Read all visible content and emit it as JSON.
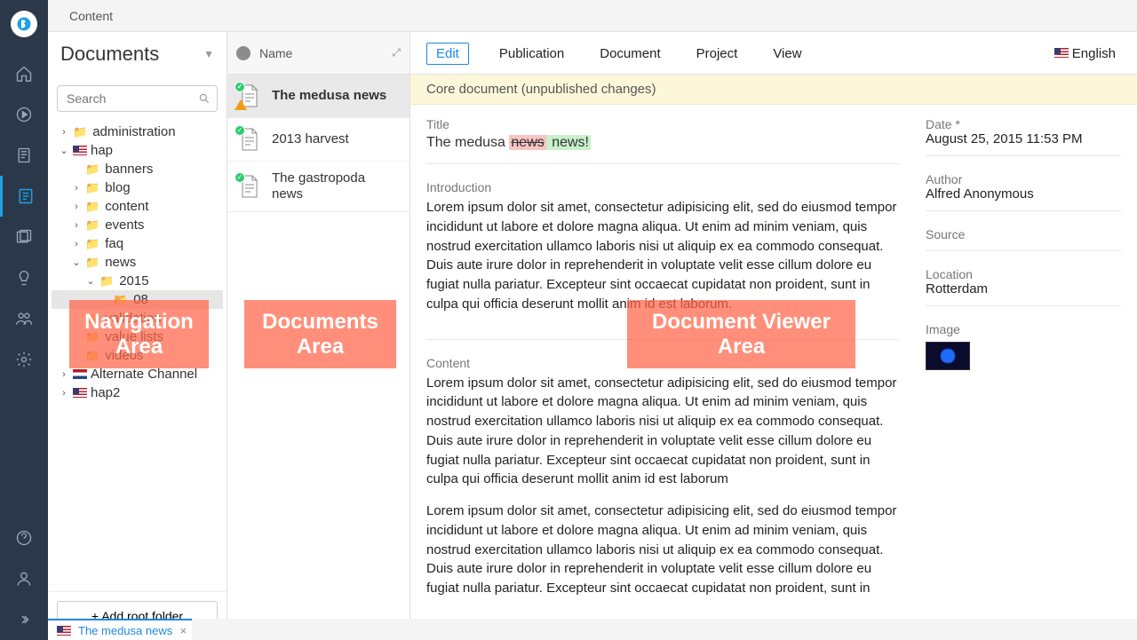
{
  "topbar": {
    "title": "Content"
  },
  "nav": {
    "header": "Documents",
    "search_placeholder": "Search",
    "add_root_label": "+ Add root folder",
    "tree": {
      "administration": "administration",
      "hap": "hap",
      "banners": "banners",
      "blog": "blog",
      "content": "content",
      "events": "events",
      "faq": "faq",
      "news": "news",
      "y2015": "2015",
      "m08": "08",
      "validation": "validation",
      "value_lists": "value lists",
      "videos": "videos",
      "alt_channel": "Alternate Channel",
      "hap2": "hap2"
    }
  },
  "docs": {
    "header_name": "Name",
    "items": [
      {
        "title": "The medusa news"
      },
      {
        "title": "2013 harvest"
      },
      {
        "title": "The gastropoda news"
      }
    ]
  },
  "viewer": {
    "menu": {
      "edit": "Edit",
      "publication": "Publication",
      "document": "Document",
      "project": "Project",
      "view": "View",
      "english": "English"
    },
    "banner": "Core document (unpublished changes)",
    "fields": {
      "title_label": "Title",
      "title_pre": "The medusa ",
      "title_del": "news",
      "title_ins": " news!",
      "intro_label": "Introduction",
      "intro_body": "Lorem ipsum dolor sit amet, consectetur adipisicing elit, sed do eiusmod tempor incididunt ut labore et dolore magna aliqua. Ut enim ad minim veniam, quis nostrud exercitation ullamco laboris nisi ut aliquip ex ea commodo consequat. Duis aute irure dolor in reprehenderit in voluptate velit esse cillum dolore eu fugiat nulla pariatur. Excepteur sint occaecat cupidatat non proident, sunt in culpa qui officia deserunt mollit anim id est laborum.",
      "content_label": "Content",
      "content_body1": "Lorem ipsum dolor sit amet, consectetur adipisicing elit, sed do eiusmod tempor incididunt ut labore et dolore magna aliqua. Ut enim ad minim veniam, quis nostrud exercitation ullamco laboris nisi ut aliquip ex ea commodo consequat. Duis aute irure dolor in reprehenderit in voluptate velit esse cillum dolore eu fugiat nulla pariatur. Excepteur sint occaecat cupidatat non proident, sunt in culpa qui officia deserunt mollit anim id est laborum",
      "content_body2": "Lorem ipsum dolor sit amet, consectetur adipisicing elit, sed do eiusmod tempor incididunt ut labore et dolore magna aliqua. Ut enim ad minim veniam, quis nostrud exercitation ullamco laboris nisi ut aliquip ex ea commodo consequat. Duis aute irure dolor in reprehenderit in voluptate velit esse cillum dolore eu fugiat nulla pariatur. Excepteur sint occaecat cupidatat non proident, sunt in"
    },
    "meta": {
      "date_label": "Date *",
      "date_value": "August 25, 2015 11:53 PM",
      "author_label": "Author",
      "author_value": "Alfred Anonymous",
      "source_label": "Source",
      "location_label": "Location",
      "location_value": "Rotterdam",
      "image_label": "Image"
    }
  },
  "bottom_tab": {
    "label": "The medusa news"
  },
  "overlays": {
    "nav": "Navigation Area",
    "docs": "Documents Area",
    "view": "Document Viewer Area"
  }
}
